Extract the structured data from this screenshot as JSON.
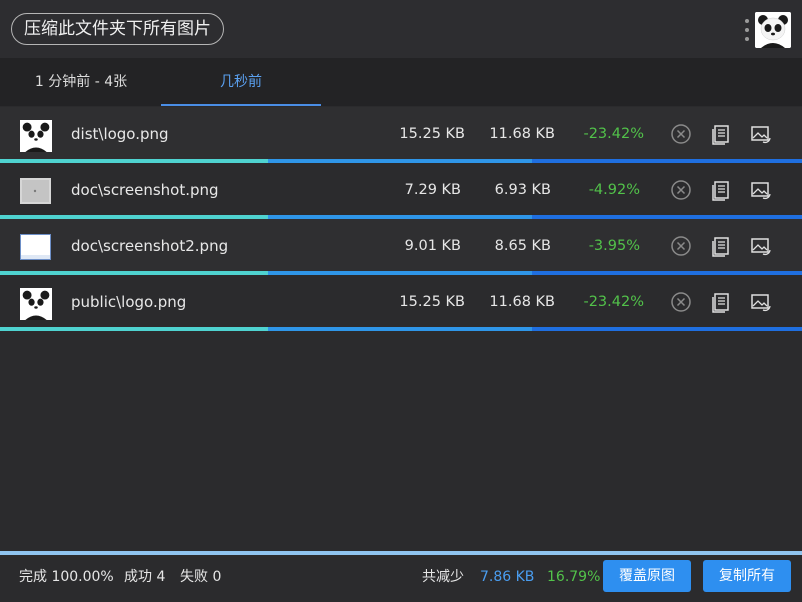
{
  "header": {
    "title": "压缩此文件夹下所有图片",
    "more_icon": "more-vertical-icon",
    "avatar_icon": "panda-avatar-icon"
  },
  "tabs": [
    {
      "label": "1 分钟前 - 4张",
      "active": false
    },
    {
      "label": "几秒前",
      "active": true
    }
  ],
  "files": [
    {
      "name": "dist\\logo.png",
      "original_size": "15.25 KB",
      "compressed_size": "11.68 KB",
      "change": "-23.42%",
      "thumb": "panda"
    },
    {
      "name": "doc\\screenshot.png",
      "original_size": "7.29 KB",
      "compressed_size": "6.93 KB",
      "change": "-4.92%",
      "thumb": "screenshot"
    },
    {
      "name": "doc\\screenshot2.png",
      "original_size": "9.01 KB",
      "compressed_size": "8.65 KB",
      "change": "-3.95%",
      "thumb": "screenshot2"
    },
    {
      "name": "public\\logo.png",
      "original_size": "15.25 KB",
      "compressed_size": "11.68 KB",
      "change": "-23.42%",
      "thumb": "panda"
    }
  ],
  "row_actions": {
    "cancel_icon": "cancel-circle-icon",
    "copy_icon": "copy-document-icon",
    "replace_icon": "replace-image-icon"
  },
  "footer": {
    "complete": "完成 100.00%",
    "success": "成功 4",
    "failed": "失败 0",
    "reduced_label": "共减少",
    "reduced_size": "7.86 KB",
    "reduced_pct": "16.79%",
    "overwrite_button": "覆盖原图",
    "copy_all_button": "复制所有"
  },
  "colors": {
    "background": "#2b2b2d",
    "accent": "#2e8ff0",
    "success": "#52c24a",
    "progress_start": "#4fd3d0",
    "progress_end": "#1f6fe0"
  }
}
